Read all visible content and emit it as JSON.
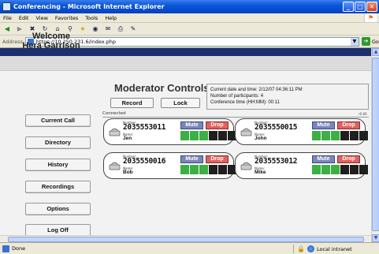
{
  "window": {
    "title": "Conferencing - Microsoft Internet Explorer",
    "buttons": {
      "minimize": "_",
      "maximize": "□",
      "close": "✕"
    }
  },
  "menu": [
    "File",
    "Edit",
    "View",
    "Favorites",
    "Tools",
    "Help"
  ],
  "toolbar": [
    "back-icon",
    "forward-icon",
    "stop-icon",
    "refresh-icon",
    "home-icon",
    "search-icon",
    "favorites-icon",
    "media-icon",
    "mail-icon",
    "print-icon",
    "edit-icon"
  ],
  "address": {
    "label": "Address",
    "url": "https://10.250.231.6/index.php",
    "go": "Go"
  },
  "status": {
    "text": "Done",
    "zone": "Local intranet"
  },
  "sidebar": {
    "welcome_line1": "Welcome",
    "welcome_line2": "Hera Garrison",
    "nav": [
      "Current Call",
      "Directory",
      "History",
      "Recordings",
      "Options",
      "Log Off"
    ]
  },
  "controls": {
    "title": "Moderator Controls",
    "record_label": "Record",
    "lock_label": "Lock",
    "info": {
      "datetime": "Current date and time:  2/12/07 04:36:11 PM",
      "participants": "Number of participants:  4",
      "duration": "Conference time (HH:MM):  00:11"
    },
    "connected_label": "Connected",
    "connected_small": "r0.60"
  },
  "participants": [
    {
      "number_label": "Number:",
      "number": "2035553011",
      "name_label": "Name:",
      "name": "Jen",
      "mute": "Mute",
      "drop": "Drop",
      "level": 0.5
    },
    {
      "number_label": "Number:",
      "number": "2035550015",
      "name_label": "Name:",
      "name": "John",
      "mute": "Mute",
      "drop": "Drop",
      "level": 0.5
    },
    {
      "number_label": "Number:",
      "number": "2035550016",
      "name_label": "Name:",
      "name": "Bob",
      "mute": "Mute",
      "drop": "Drop",
      "level": 0.5
    },
    {
      "number_label": "Number:",
      "number": "2035553012",
      "name_label": "Name:",
      "name": "Mike",
      "mute": "Mute",
      "drop": "Drop",
      "level": 0.5
    }
  ],
  "colors": {
    "accent_navy": "#1c2f6e",
    "mute": "#7a86b8",
    "drop": "#e0615f",
    "meter_on": "#3cb043"
  }
}
